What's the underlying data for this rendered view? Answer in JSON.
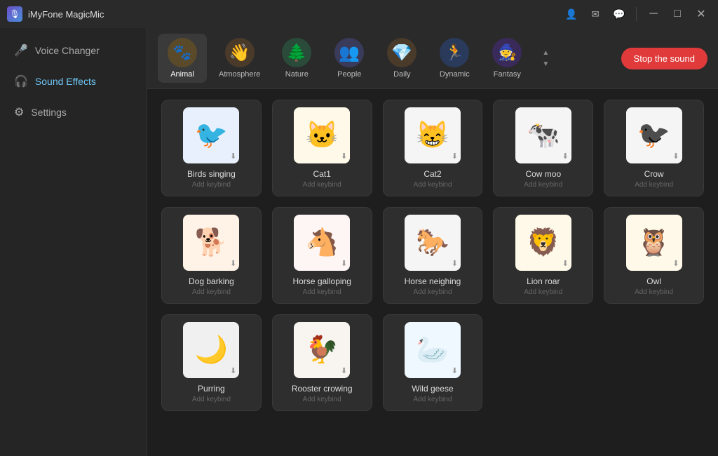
{
  "app": {
    "name": "iMyFone MagicMic",
    "icon": "🎙"
  },
  "titlebar": {
    "controls": [
      "👤",
      "✉",
      "💬",
      "−",
      "□",
      "✕"
    ]
  },
  "sidebar": {
    "items": [
      {
        "id": "voice-changer",
        "label": "Voice Changer",
        "icon": "🎤",
        "active": false
      },
      {
        "id": "sound-effects",
        "label": "Sound Effects",
        "icon": "🎧",
        "active": true
      },
      {
        "id": "settings",
        "label": "Settings",
        "icon": "⚙",
        "active": false
      }
    ]
  },
  "categories": [
    {
      "id": "animal",
      "label": "Animal",
      "icon": "🐾",
      "active": true
    },
    {
      "id": "atmosphere",
      "label": "Atmosphere",
      "icon": "👋",
      "active": false
    },
    {
      "id": "nature",
      "label": "Nature",
      "icon": "🌲",
      "active": false
    },
    {
      "id": "people",
      "label": "People",
      "icon": "👥",
      "active": false
    },
    {
      "id": "daily",
      "label": "Daily",
      "icon": "💎",
      "active": false
    },
    {
      "id": "dynamic",
      "label": "Dynamic",
      "icon": "🏃",
      "active": false
    },
    {
      "id": "fantasy",
      "label": "Fantasy",
      "icon": "🧙",
      "active": false
    }
  ],
  "stop_button": "Stop the sound",
  "sounds": [
    {
      "id": "birds-singing",
      "name": "Birds singing",
      "keybind": "Add keybind",
      "emoji": "🐦",
      "bg": "#e8f0fe"
    },
    {
      "id": "cat1",
      "name": "Cat1",
      "keybind": "Add keybind",
      "emoji": "🐱",
      "bg": "#fef9e8"
    },
    {
      "id": "cat2",
      "name": "Cat2",
      "keybind": "Add keybind",
      "emoji": "😸",
      "bg": "#f5f5f5"
    },
    {
      "id": "cow-moo",
      "name": "Cow moo",
      "keybind": "Add keybind",
      "emoji": "🐄",
      "bg": "#f5f5f5"
    },
    {
      "id": "crow",
      "name": "Crow",
      "keybind": "Add keybind",
      "emoji": "🐦‍⬛",
      "bg": "#f5f5f5"
    },
    {
      "id": "dog-barking",
      "name": "Dog barking",
      "keybind": "Add keybind",
      "emoji": "🐕",
      "bg": "#fff3e8"
    },
    {
      "id": "horse-galloping",
      "name": "Horse galloping",
      "keybind": "Add keybind",
      "emoji": "🐴",
      "bg": "#fef5f5"
    },
    {
      "id": "horse-neighing",
      "name": "Horse neighing",
      "keybind": "Add keybind",
      "emoji": "🐎",
      "bg": "#f5f5f5"
    },
    {
      "id": "lion-roar",
      "name": "Lion roar",
      "keybind": "Add keybind",
      "emoji": "🦁",
      "bg": "#fef9e8"
    },
    {
      "id": "owl",
      "name": "Owl",
      "keybind": "Add keybind",
      "emoji": "🦉",
      "bg": "#fef9e8"
    },
    {
      "id": "purring",
      "name": "Purring",
      "keybind": "Add keybind",
      "emoji": "🌙",
      "bg": "#f0f0f0"
    },
    {
      "id": "rooster-crowing",
      "name": "Rooster crowing",
      "keybind": "Add keybind",
      "emoji": "🐓",
      "bg": "#f8f5f0"
    },
    {
      "id": "wild-geese",
      "name": "Wild geese",
      "keybind": "Add keybind",
      "emoji": "🦢",
      "bg": "#f0f8ff"
    }
  ]
}
